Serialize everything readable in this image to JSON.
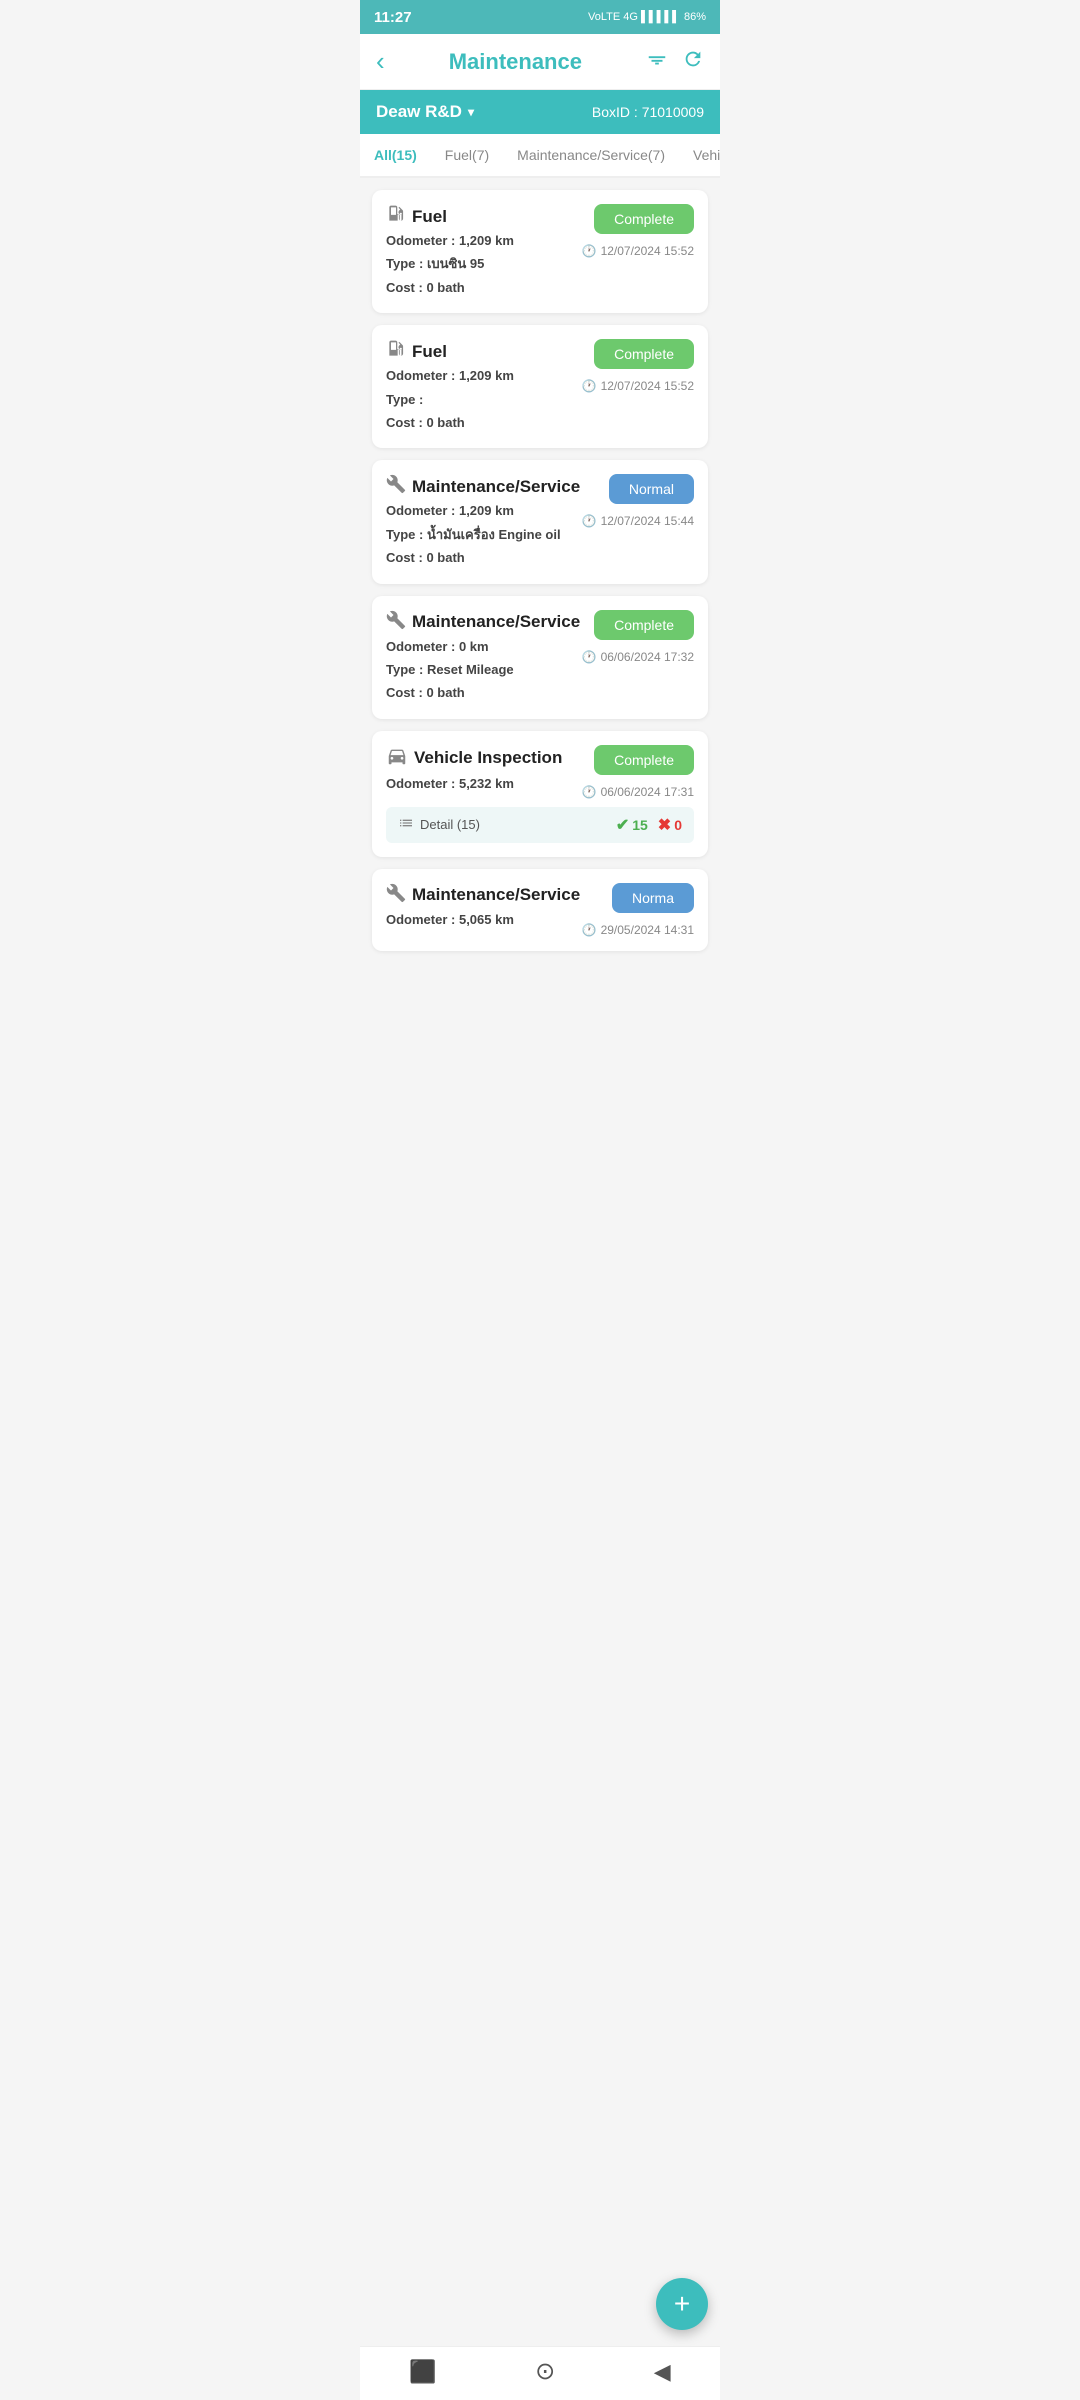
{
  "status_bar": {
    "time": "11:27",
    "battery": "86%"
  },
  "header": {
    "title": "Maintenance",
    "back_label": "‹",
    "filter_label": "⛉",
    "refresh_label": "↻"
  },
  "sub_header": {
    "org": "Deaw  R&D",
    "box_id_label": "BoxID :",
    "box_id": "71010009"
  },
  "tabs": [
    {
      "label": "All(15)",
      "active": true
    },
    {
      "label": "Fuel(7)",
      "active": false
    },
    {
      "label": "Maintenance/Service(7)",
      "active": false
    },
    {
      "label": "Vehicle Inspection(",
      "active": false
    }
  ],
  "cards": [
    {
      "type": "fuel",
      "icon": "⛽",
      "title": "Fuel",
      "status": "Complete",
      "status_type": "complete",
      "odometer": "1,209 km",
      "type_label": "เบนซิน 95",
      "cost": "0 bath",
      "date": "12/07/2024  15:52"
    },
    {
      "type": "fuel",
      "icon": "⛽",
      "title": "Fuel",
      "status": "Complete",
      "status_type": "complete",
      "odometer": "1,209 km",
      "type_label": "",
      "cost": "0 bath",
      "date": "12/07/2024  15:52"
    },
    {
      "type": "maintenance",
      "icon": "🔧",
      "title": "Maintenance/Service",
      "status": "Normal",
      "status_type": "normal",
      "odometer": "1,209 km",
      "type_label": "น้ำมันเครื่อง Engine oil",
      "cost": "0 bath",
      "date": "12/07/2024  15:44"
    },
    {
      "type": "maintenance",
      "icon": "🔧",
      "title": "Maintenance/Service",
      "status": "Complete",
      "status_type": "complete",
      "odometer": "0 km",
      "type_label": "Reset Mileage",
      "cost": "0 bath",
      "date": "06/06/2024  17:32"
    },
    {
      "type": "vehicle_inspection",
      "icon": "🚗",
      "title": "Vehicle Inspection",
      "status": "Complete",
      "status_type": "complete",
      "odometer": "5,232 km",
      "type_label": null,
      "cost": null,
      "date": "06/06/2024  17:31",
      "detail_label": "Detail (15)",
      "count_ok": "15",
      "count_fail": "0"
    },
    {
      "type": "maintenance",
      "icon": "🔧",
      "title": "Maintenance/Service",
      "status": "Norma",
      "status_type": "normal",
      "odometer": "5,065 km",
      "type_label": null,
      "cost": null,
      "date": "29/05/2024  14:31"
    }
  ],
  "fab": {
    "label": "+"
  },
  "bottom_nav": {
    "square": "■",
    "circle": "⊙",
    "back": "◀"
  },
  "labels": {
    "odometer_prefix": "Odometer : ",
    "type_prefix": "Type : ",
    "cost_prefix": "Cost : "
  }
}
